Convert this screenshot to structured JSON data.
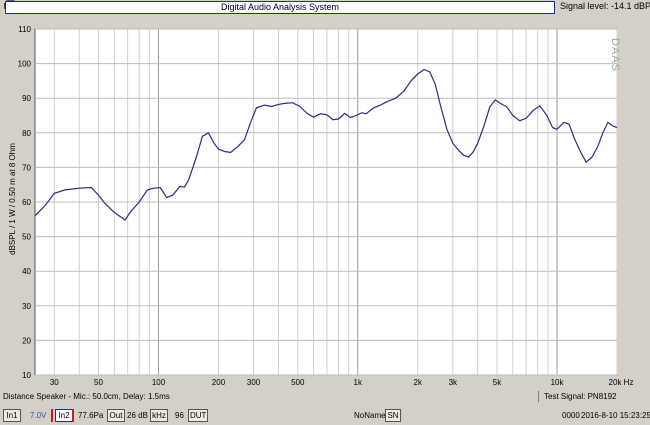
{
  "titlebar": {
    "title": "Digital Audio Analysis System",
    "signal_level": "Signal level: -14.1 dBPa",
    "print_icon": "printer-icon"
  },
  "chart_data": {
    "type": "line",
    "x_scale": "log",
    "xlim": [
      24,
      20000
    ],
    "ylim": [
      10,
      110
    ],
    "ylabel": "dBSPL / 1 W / 0.50 m at 8 Ohm",
    "y_ticks": [
      "10",
      "20",
      "30",
      "40",
      "50",
      "60",
      "70",
      "80",
      "90",
      "100",
      "110"
    ],
    "x_ticks": [
      "30",
      "50",
      "100",
      "200",
      "300",
      "500",
      "1k",
      "2k",
      "3k",
      "5k",
      "10k",
      "20k Hz"
    ],
    "x_tick_values": [
      30,
      50,
      100,
      200,
      300,
      500,
      1000,
      2000,
      3000,
      5000,
      10000,
      20000
    ],
    "watermark": "DAAS",
    "grid": true,
    "line_color": "#2a2a8c",
    "series": [
      {
        "x": [
          24,
          27,
          30,
          34,
          40,
          46,
          50,
          54,
          60,
          68,
          72,
          80,
          88,
          95,
          102,
          110,
          118,
          128,
          135,
          142,
          155,
          166,
          178,
          190,
          200,
          215,
          230,
          250,
          270,
          290,
          310,
          340,
          370,
          400,
          430,
          470,
          510,
          560,
          600,
          650,
          700,
          750,
          800,
          860,
          920,
          980,
          1050,
          1100,
          1200,
          1300,
          1400,
          1550,
          1700,
          1850,
          2000,
          2150,
          2300,
          2450,
          2600,
          2800,
          3000,
          3200,
          3400,
          3600,
          3800,
          4000,
          4300,
          4600,
          4900,
          5200,
          5600,
          6000,
          6500,
          7000,
          7600,
          8200,
          8900,
          9500,
          10000,
          10800,
          11500,
          12200,
          13000,
          14000,
          15000,
          16000,
          17000,
          18000,
          19000,
          20000
        ],
        "y": [
          56.0,
          59.0,
          62.5,
          63.5,
          64.0,
          64.2,
          62.0,
          59.5,
          57.0,
          54.8,
          57.0,
          60.0,
          63.5,
          64.0,
          64.2,
          61.3,
          62.0,
          64.5,
          64.3,
          66.5,
          73.0,
          79.0,
          80.0,
          77.0,
          75.3,
          74.6,
          74.3,
          76.0,
          78.0,
          83.0,
          87.2,
          88.0,
          87.6,
          88.2,
          88.5,
          88.7,
          87.7,
          85.5,
          84.5,
          85.5,
          85.2,
          83.8,
          84.0,
          85.6,
          84.4,
          85.0,
          85.8,
          85.5,
          87.2,
          88.0,
          89.0,
          90.0,
          92.0,
          95.0,
          97.0,
          98.3,
          97.6,
          94.0,
          88.0,
          81.0,
          77.0,
          75.0,
          73.5,
          73.0,
          74.5,
          77.0,
          82.0,
          87.5,
          89.5,
          88.5,
          87.5,
          85.0,
          83.5,
          84.2,
          86.5,
          87.8,
          85.0,
          81.5,
          81.0,
          83.0,
          82.5,
          78.5,
          75.0,
          71.5,
          73.0,
          76.0,
          80.0,
          83.0,
          82.0,
          81.5
        ]
      }
    ]
  },
  "status_bar": {
    "left": "Distance Speaker - Mic.: 50.0cm, Delay: 1.5ms",
    "right": "Test Signal: PN8192"
  },
  "bottom_bar": {
    "in1_label": "In1",
    "in1_volt": "7.0V",
    "in2_label": "In2",
    "in2_pa": "77.6Pa",
    "out_label": "Out",
    "out_db": "26 dB",
    "khz_label": "kHz",
    "dut_value": "96",
    "dut_label": "DUT",
    "name_value": "NoName",
    "sn_label": "SN",
    "counter": "0000",
    "datetime": "2016-8-10  15:23:25"
  }
}
